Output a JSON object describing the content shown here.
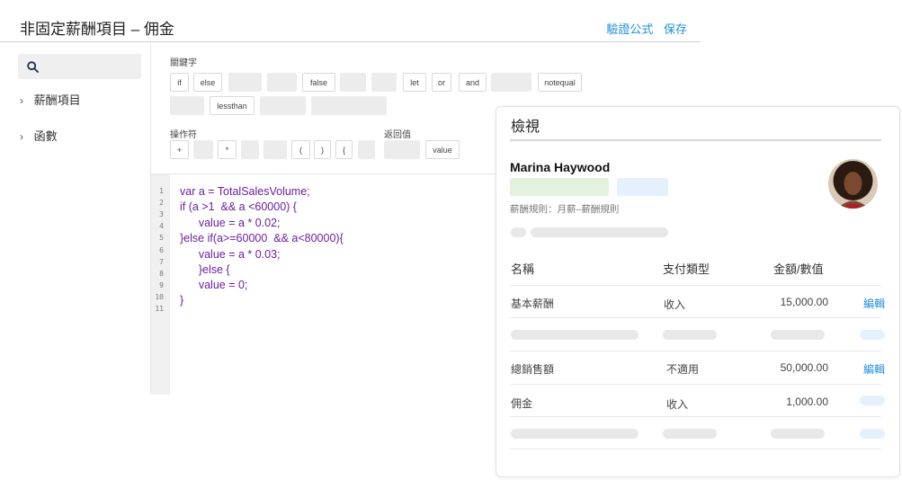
{
  "header": {
    "title": "非固定薪酬項目 – 佣金",
    "verify_label": "驗證公式",
    "save_label": "保存"
  },
  "sidebar": {
    "search_icon": "search-icon",
    "items": [
      {
        "label": "薪酬項目",
        "icon": "chevron-right-icon"
      },
      {
        "label": "函數",
        "icon": "chevron-right-icon"
      }
    ]
  },
  "keywords": {
    "label": "關鍵字",
    "row1": [
      "if",
      "else",
      "",
      "",
      "false",
      "",
      "",
      "let",
      "or",
      "and",
      "",
      "notequal"
    ],
    "row2": [
      "",
      "lessthan",
      "",
      ""
    ]
  },
  "operators": {
    "label": "操作符",
    "items": [
      "+",
      "",
      "*",
      "",
      "",
      "(",
      ")",
      "{",
      ""
    ]
  },
  "return_values": {
    "label": "返回值",
    "items": [
      "",
      "value"
    ]
  },
  "code": {
    "line_numbers": [
      "1",
      "2",
      "3",
      "4",
      "5",
      "6",
      "7",
      "8",
      "9",
      "10",
      "11"
    ],
    "lines": [
      "var a = TotalSalesVolume;",
      "if (a >1  && a <60000) {",
      "      value = a * 0.02;",
      "}else if(a>=60000  && a<80000){",
      "      value = a * 0.03;",
      "      }else {",
      "      value = 0;",
      "}"
    ]
  },
  "preview": {
    "title": "檢視",
    "employee_name": "Marina Haywood",
    "rule_text": "薪酬規則：月薪–薪酬規則",
    "columns": {
      "name": "名稱",
      "type": "支付類型",
      "amount": "金額/數值"
    },
    "rows": [
      {
        "name": "基本薪酬",
        "type": "收入",
        "amount": "15,000.00",
        "action": "編輯"
      },
      {
        "name": "總銷售額",
        "type": "不適用",
        "amount": "50,000.00",
        "action": "編輯"
      },
      {
        "name": "佣金",
        "type": "收入",
        "amount": "1,000.00",
        "action": ""
      }
    ]
  },
  "colors": {
    "link": "#1f8fdc",
    "code": "#6a1fa0",
    "badge_green": "#e3f2dd",
    "badge_blue": "#e4f1fd"
  }
}
